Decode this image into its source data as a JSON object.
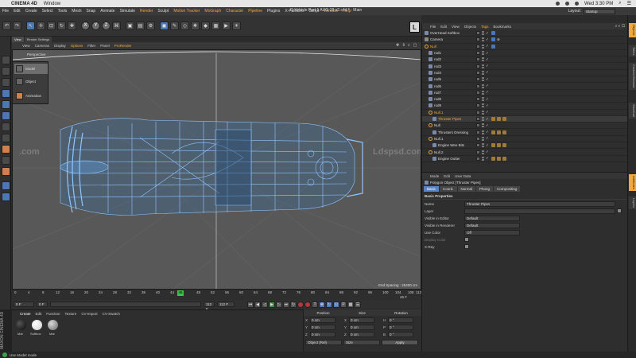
{
  "mac": {
    "app_name": "CINEMA 4D",
    "menus": [
      "Window"
    ],
    "clock": "Wed 3:30 PM"
  },
  "menubar": {
    "items": [
      "File",
      "Edit",
      "Create",
      "Select",
      "Tools",
      "Mesh",
      "Snap",
      "Animate",
      "Simulate",
      "Render",
      "Sculpt",
      "Motion Tracker",
      "MoGraph",
      "Character",
      "Pipeline",
      "Plugins",
      "X-Particles",
      "Script",
      "Window",
      "Help"
    ]
  },
  "document_title": "Q-Vehicle Part 1 AUG-23 v2.c4d * - Main",
  "layout": {
    "label": "Layout:",
    "value": "Startup"
  },
  "toolbar": {
    "render_settings_label": "Render Settings",
    "axis_x": "X",
    "axis_y": "Y",
    "axis_z": "Z",
    "cube_letter": "L"
  },
  "mode_flyout": [
    "Model",
    "Object",
    "Animation"
  ],
  "viewport": {
    "tabs": [
      "View",
      "Render Settings"
    ],
    "menus": [
      "View",
      "Cameras",
      "Display",
      "Options",
      "Filter",
      "Panel",
      "ProRender"
    ],
    "camera_label": "Perspective",
    "grid_spacing": "Grid Spacing : 25400 cm",
    "watermark": ".com",
    "watermark2": "Ldspsd.com"
  },
  "timeline": {
    "ticks": [
      "0",
      "4",
      "8",
      "12",
      "16",
      "20",
      "24",
      "28",
      "32",
      "36",
      "40",
      "44",
      "48",
      "52",
      "56",
      "60",
      "64",
      "68",
      "72",
      "76",
      "80",
      "84",
      "88",
      "92",
      "96",
      "100",
      "104",
      "108",
      "112"
    ],
    "current_frame": "46",
    "end_marker": "46 F"
  },
  "transport": {
    "start_field": "0 F",
    "min_field": "0 F",
    "max_field": "112 F",
    "end_field": "112 F"
  },
  "materials": {
    "tabs": [
      "Create",
      "Edit",
      "Function",
      "Texture",
      "CV-Import",
      "CV-Swatch"
    ],
    "items": [
      {
        "label": "Mat",
        "color": "#1a1a1a"
      },
      {
        "label": "Softbox",
        "color": "#f2f2f2"
      },
      {
        "label": "Mat",
        "color": "#9a9a9a"
      }
    ],
    "vendor": "MAXON CINEMA 4D"
  },
  "coordinates": {
    "headers": [
      "Position",
      "Size",
      "Rotation"
    ],
    "rows": [
      {
        "p_axis": "X",
        "p": "0 cm",
        "s_axis": "X",
        "s": "0 cm",
        "r_axis": "H",
        "r": "0 °"
      },
      {
        "p_axis": "Y",
        "p": "0 cm",
        "s_axis": "Y",
        "s": "0 cm",
        "r_axis": "P",
        "r": "0 °"
      },
      {
        "p_axis": "Z",
        "p": "0 cm",
        "s_axis": "Z",
        "s": "0 cm",
        "r_axis": "B",
        "r": "0 °"
      }
    ],
    "mode_dropdown": "Object (Rel)",
    "size_dropdown": "Size",
    "apply_label": "Apply"
  },
  "status": {
    "text": "Use Model mode"
  },
  "object_manager": {
    "menus": [
      "File",
      "Edit",
      "View",
      "Objects",
      "Tags",
      "Bookmarks"
    ],
    "rows": [
      {
        "name": "OverHead Softbox",
        "indent": 0,
        "orange": false,
        "icon": "light",
        "tags": [
          "c"
        ]
      },
      {
        "name": "Camera",
        "indent": 0,
        "orange": false,
        "icon": "cam",
        "tags": [
          "c",
          "x"
        ]
      },
      {
        "name": "Null",
        "indent": 0,
        "orange": true,
        "icon": "null",
        "tags": [
          "c"
        ]
      },
      {
        "name": "rod1",
        "indent": 1,
        "orange": false,
        "icon": "obj",
        "tags": []
      },
      {
        "name": "rod2",
        "indent": 1,
        "orange": false,
        "icon": "obj",
        "tags": []
      },
      {
        "name": "rod3",
        "indent": 1,
        "orange": false,
        "icon": "obj",
        "tags": []
      },
      {
        "name": "rod4",
        "indent": 1,
        "orange": false,
        "icon": "obj",
        "tags": []
      },
      {
        "name": "rod5",
        "indent": 1,
        "orange": false,
        "icon": "obj",
        "tags": []
      },
      {
        "name": "rod6",
        "indent": 1,
        "orange": false,
        "icon": "obj",
        "tags": []
      },
      {
        "name": "rod7",
        "indent": 1,
        "orange": false,
        "icon": "obj",
        "tags": []
      },
      {
        "name": "rod8",
        "indent": 1,
        "orange": false,
        "icon": "obj",
        "tags": []
      },
      {
        "name": "rod9",
        "indent": 1,
        "orange": false,
        "icon": "obj",
        "tags": []
      },
      {
        "name": "Null.1",
        "indent": 1,
        "orange": true,
        "icon": "null",
        "tags": []
      },
      {
        "name": "Thruster Pipes",
        "indent": 2,
        "orange": true,
        "icon": "obj",
        "tags": [
          "a",
          "a",
          "a"
        ],
        "selected": true
      },
      {
        "name": "Null",
        "indent": 1,
        "orange": false,
        "icon": "null",
        "tags": []
      },
      {
        "name": "Thrusters Dressing",
        "indent": 2,
        "orange": false,
        "icon": "obj",
        "tags": [
          "a",
          "a",
          "a"
        ]
      },
      {
        "name": "Null.1",
        "indent": 1,
        "orange": false,
        "icon": "null",
        "tags": []
      },
      {
        "name": "Engine Wee Bits",
        "indent": 2,
        "orange": false,
        "icon": "obj",
        "tags": [
          "a",
          "a",
          "a"
        ]
      },
      {
        "name": "Null.2",
        "indent": 1,
        "orange": false,
        "icon": "null",
        "tags": []
      },
      {
        "name": "Engine Outter",
        "indent": 2,
        "orange": false,
        "icon": "obj",
        "tags": [
          "a",
          "a",
          "a"
        ]
      }
    ]
  },
  "right_tabs": [
    "Objects",
    "Takes",
    "Content Browser",
    "Structure",
    "Attributes",
    "Layers"
  ],
  "attributes": {
    "menus": [
      "Mode",
      "Edit",
      "User Data"
    ],
    "object_line": "Polygon Object [Thruster Pipes]",
    "tabs": [
      "Basic",
      "Coord.",
      "Normal",
      "Phong",
      "Compositing"
    ],
    "section": "Basic Properties",
    "rows": [
      {
        "label": "Name",
        "value": "Thruster Pipes"
      },
      {
        "label": "Layer",
        "value": ""
      },
      {
        "label": "Visible in Editor",
        "value": "Default"
      },
      {
        "label": "Visible in Renderer",
        "value": "Default"
      },
      {
        "label": "Use Color",
        "value": "Off"
      },
      {
        "label": "Display Color",
        "value": ""
      },
      {
        "label": "X-Ray",
        "value": ""
      }
    ]
  }
}
